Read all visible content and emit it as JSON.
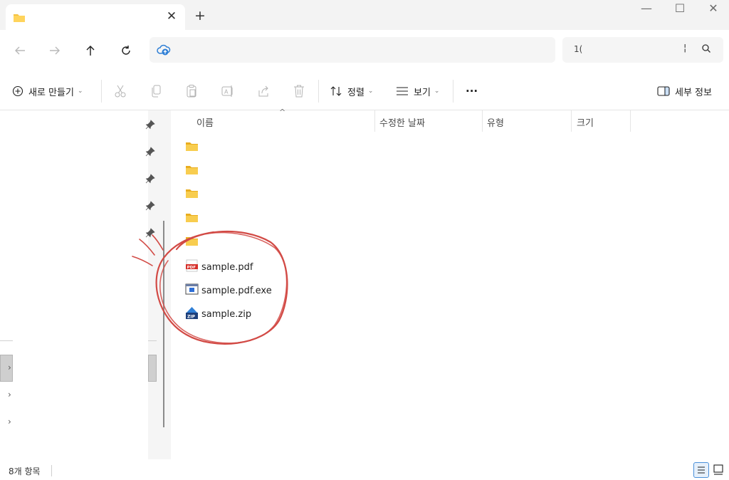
{
  "window": {
    "tab": {
      "title": "",
      "close_glyph": "✕"
    },
    "new_tab_glyph": "+",
    "controls": [
      "—",
      "☐",
      "✕"
    ]
  },
  "address": {
    "path": "",
    "search_text": "1("
  },
  "toolbar": {
    "new_label": "새로 만들기",
    "sort_label": "정렬",
    "view_label": "보기",
    "more_label": "···",
    "details_label": "세부 정보"
  },
  "columns": {
    "name": "이름",
    "modified": "수정한 날짜",
    "type": "유형",
    "size": "크기"
  },
  "files": [
    {
      "name": "",
      "icon": "folder-icon"
    },
    {
      "name": "",
      "icon": "folder-icon"
    },
    {
      "name": "",
      "icon": "folder-icon"
    },
    {
      "name": "",
      "icon": "folder-icon"
    },
    {
      "name": "",
      "icon": "folder-icon"
    },
    {
      "name": "sample.pdf",
      "icon": "pdf-file-icon"
    },
    {
      "name": "sample.pdf.exe",
      "icon": "exe-file-icon"
    },
    {
      "name": "sample.zip",
      "icon": "zip-file-icon"
    }
  ],
  "status": {
    "item_count": "8개 항목"
  },
  "colors": {
    "folder": "#f4c242",
    "pdf_red": "#d6302a",
    "annotation_red": "#d24a45",
    "accent_blue": "#2f7fd6"
  }
}
